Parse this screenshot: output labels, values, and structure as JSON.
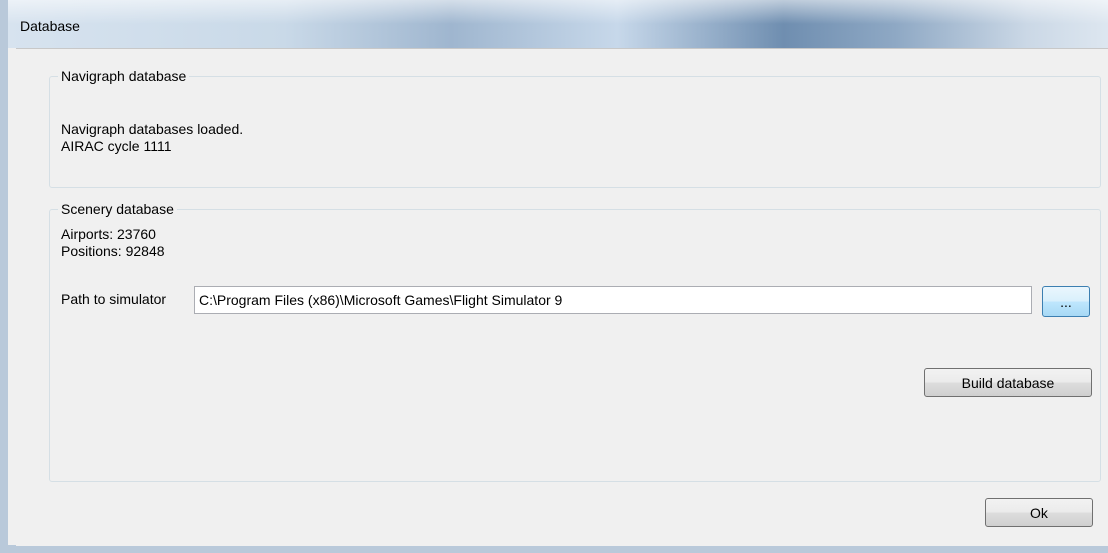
{
  "window": {
    "title": "Database"
  },
  "navigraph": {
    "group_label": "Navigraph database",
    "status": "Navigraph databases loaded.",
    "airac": "AIRAC cycle 1111"
  },
  "scenery": {
    "group_label": "Scenery database",
    "airports": "Airports: 23760",
    "positions": "Positions: 92848",
    "path_label": "Path to simulator",
    "path_value": "C:\\Program Files (x86)\\Microsoft Games\\Flight Simulator 9",
    "browse_label": "...",
    "build_label": "Build database"
  },
  "footer": {
    "ok_label": "Ok"
  },
  "colors": {
    "background": "#f0f0f0",
    "group_border": "#d5dfe5",
    "browse_hover": "#bee6fd"
  }
}
